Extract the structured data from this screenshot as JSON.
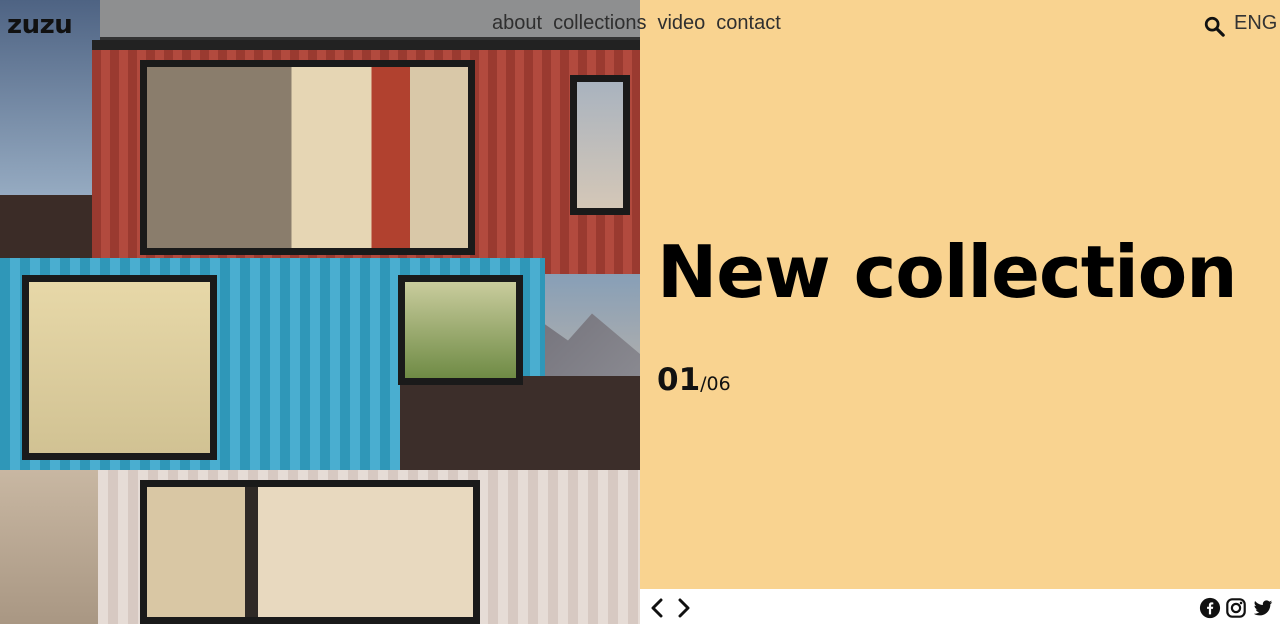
{
  "brand": {
    "logo_text": "zuzu"
  },
  "nav": {
    "items": [
      {
        "label": "about"
      },
      {
        "label": "collections"
      },
      {
        "label": "video"
      },
      {
        "label": "contact"
      }
    ]
  },
  "header": {
    "search_icon": "search-icon",
    "language": "ENG"
  },
  "hero": {
    "headline": "New collection",
    "slide_current": "01",
    "slide_total": "/06",
    "background_color": "#f9d390"
  },
  "footer": {
    "prev_icon": "chevron-left-icon",
    "next_icon": "chevron-right-icon",
    "social_icons": [
      "facebook-icon",
      "instagram-icon",
      "twitter-icon"
    ]
  }
}
